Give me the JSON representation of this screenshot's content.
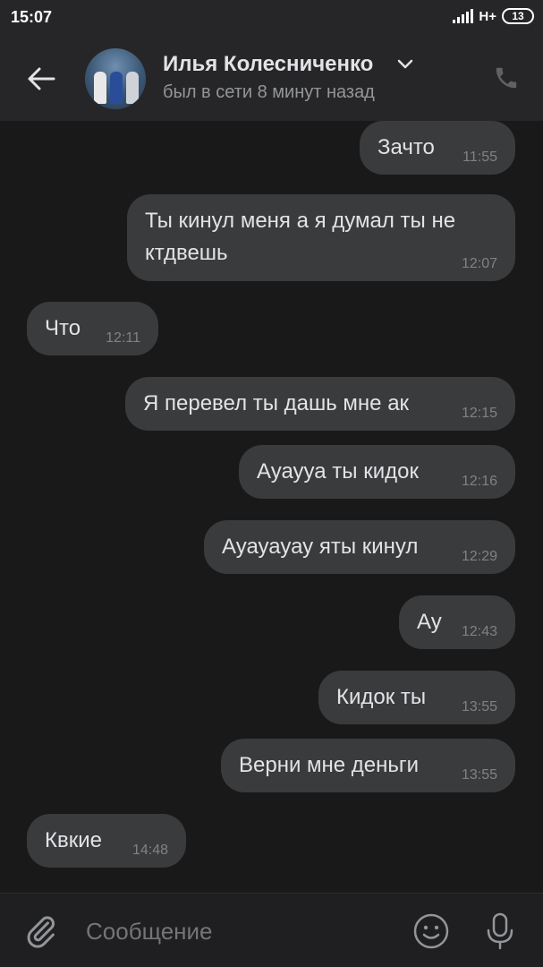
{
  "status_bar": {
    "time": "15:07",
    "network": "H+",
    "battery": "13"
  },
  "header": {
    "contact_name": "Илья Колесниченко",
    "last_seen": "был в сети 8 минут назад",
    "icons": [
      "back-arrow-icon",
      "chevron-down-icon",
      "phone-icon"
    ]
  },
  "messages": [
    {
      "direction": "out",
      "lines": [
        "Зачто"
      ],
      "time": "11:55"
    },
    {
      "direction": "out",
      "lines": [
        "Ты кинул меня а я думал ты не",
        "ктдвешь"
      ],
      "time": "12:07"
    },
    {
      "direction": "in",
      "lines": [
        "Что"
      ],
      "time": "12:11"
    },
    {
      "direction": "out",
      "lines": [
        "Я перевел ты дашь мне ак"
      ],
      "time": "12:15"
    },
    {
      "direction": "out",
      "lines": [
        "Ауаууа ты кидок"
      ],
      "time": "12:16"
    },
    {
      "direction": "out",
      "lines": [
        "Ауауауау яты кинул"
      ],
      "time": "12:29"
    },
    {
      "direction": "out",
      "lines": [
        "Ау"
      ],
      "time": "12:43"
    },
    {
      "direction": "out",
      "lines": [
        "Кидок ты"
      ],
      "time": "13:55"
    },
    {
      "direction": "out",
      "lines": [
        "Верни мне деньги"
      ],
      "time": "13:55"
    },
    {
      "direction": "in",
      "lines": [
        "Квкие"
      ],
      "time": "14:48"
    }
  ],
  "composer": {
    "placeholder": "Сообщение",
    "icons": [
      "attach-icon",
      "emoji-icon",
      "mic-icon"
    ]
  },
  "colors": {
    "background": "#19191a",
    "header": "#262628",
    "bubble": "#3a3b3d",
    "text": "#e1e3e6",
    "secondary_text": "#939699"
  }
}
